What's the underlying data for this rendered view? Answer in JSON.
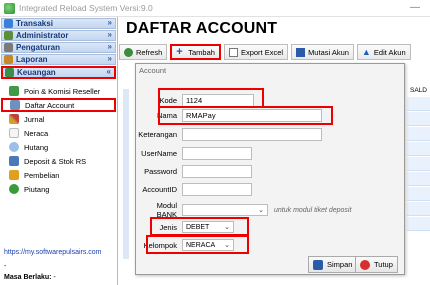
{
  "window": {
    "title": "Integrated Reload System Versi:9.0",
    "minimize": "—"
  },
  "sidebar": {
    "groups": [
      {
        "label": "Transaksi",
        "chevron": "»"
      },
      {
        "label": "Administrator",
        "chevron": "»"
      },
      {
        "label": "Pengaturan",
        "chevron": "»"
      },
      {
        "label": "Laporan",
        "chevron": "»"
      },
      {
        "label": "Keuangan",
        "chevron": "«"
      }
    ],
    "items": [
      {
        "label": "Poin & Komisi Reseller"
      },
      {
        "label": "Daftar Account"
      },
      {
        "label": "Jurnal"
      },
      {
        "label": "Neraca"
      },
      {
        "label": "Hutang"
      },
      {
        "label": "Deposit & Stok RS"
      },
      {
        "label": "Pembelian"
      },
      {
        "label": "Piutang"
      }
    ],
    "link": "https://my.softwarepulsairs.com",
    "dash": "-",
    "masa_label": "Masa Berlaku:",
    "masa_value": "-"
  },
  "main": {
    "title": "DAFTAR ACCOUNT",
    "toolbar": {
      "refresh": "Refresh",
      "tambah": "Tambah",
      "export": "Export Excel",
      "mutasi": "Mutasi Akun",
      "edit": "Edit Akun"
    },
    "grid_header": "SALD"
  },
  "dialog": {
    "title": "Account",
    "fields": {
      "kode_label": "Kode",
      "kode_value": "1124",
      "nama_label": "Nama",
      "nama_value": "RMAPay",
      "keterangan_label": "Keterangan",
      "keterangan_value": "",
      "username_label": "UserName",
      "username_value": "",
      "password_label": "Password",
      "password_value": "",
      "accountid_label": "AccountID",
      "accountid_value": "",
      "modulbank_label": "Modul BANK",
      "modulbank_value": "",
      "modulbank_note": "untuk modul tiket deposit",
      "jenis_label": "Jenis",
      "jenis_value": "DEBET",
      "kelompok_label": "Kelompok",
      "kelompok_value": "NERACA"
    },
    "buttons": {
      "simpan": "Simpan",
      "tutup": "Tutup"
    }
  },
  "colors": {
    "accent_red": "#e00000",
    "header_blue": "#163a78"
  }
}
